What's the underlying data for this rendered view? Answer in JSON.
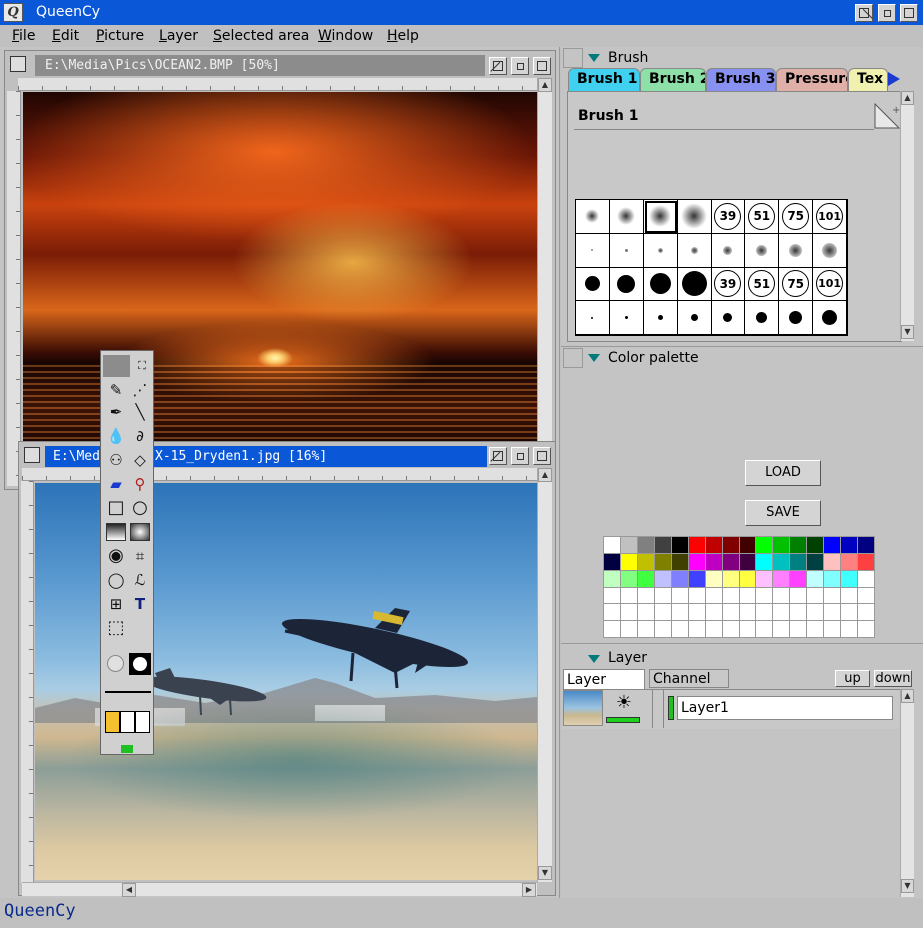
{
  "app": {
    "title": "QueenCy",
    "logo_letter": "Q",
    "status_text": "QueenCy"
  },
  "menu": [
    {
      "first": "F",
      "rest": "ile"
    },
    {
      "first": "E",
      "rest": "dit"
    },
    {
      "first": "P",
      "rest": "icture"
    },
    {
      "first": "L",
      "rest": "ayer"
    },
    {
      "first": "S",
      "rest": "elected area"
    },
    {
      "first": "W",
      "rest": "indow"
    },
    {
      "first": "H",
      "rest": "elp"
    }
  ],
  "documents": {
    "ocean": {
      "title": "E:\\Media\\Pics\\OCEAN2.BMP [50%]"
    },
    "jet": {
      "title_left": "E:\\Med",
      "title_right": "X-15_Dryden1.jpg [16%]"
    }
  },
  "brush_panel": {
    "header": "Brush",
    "tabs": [
      "Brush 1",
      "Brush 2",
      "Brush 3",
      "Pressure",
      "Tex"
    ],
    "tab_colors": [
      "#40d0f0",
      "#8de0a8",
      "#8890f0",
      "#e0b0a8",
      "#f0f0b0"
    ],
    "current_name": "Brush 1",
    "size_labels": [
      "39",
      "51",
      "75",
      "101"
    ]
  },
  "color_panel": {
    "header": "Color palette",
    "load_label": "LOAD",
    "save_label": "SAVE",
    "colors": [
      "#ffffff",
      "#c0c0c0",
      "#808080",
      "#404040",
      "#000000",
      "#ff0000",
      "#c00000",
      "#800000",
      "#400000",
      "#00ff00",
      "#00c000",
      "#008000",
      "#004000",
      "#0000ff",
      "#0000c0",
      "#000080",
      "#000040",
      "#ffff00",
      "#c0c000",
      "#808000",
      "#404000",
      "#ff00ff",
      "#c000c0",
      "#800080",
      "#400040",
      "#00ffff",
      "#00c0c0",
      "#008080",
      "#004040",
      "#ffc0c0",
      "#ff8080",
      "#ff4040",
      "#c0ffc0",
      "#80ff80",
      "#40ff40",
      "#c0c0ff",
      "#8080ff",
      "#4040ff",
      "#ffffc0",
      "#ffff80",
      "#ffff40",
      "#ffc0ff",
      "#ff80ff",
      "#ff40ff",
      "#c0ffff",
      "#80ffff",
      "#40ffff",
      "#ffffff"
    ]
  },
  "layer_panel": {
    "header": "Layer",
    "tab_layer": "Layer",
    "tab_channel": "Channel",
    "up_label": "up",
    "down_label": "down",
    "layer_name": "Layer1"
  },
  "colors": {
    "title_bar": "#0a58d8",
    "accent_teal": "#007a7a"
  }
}
